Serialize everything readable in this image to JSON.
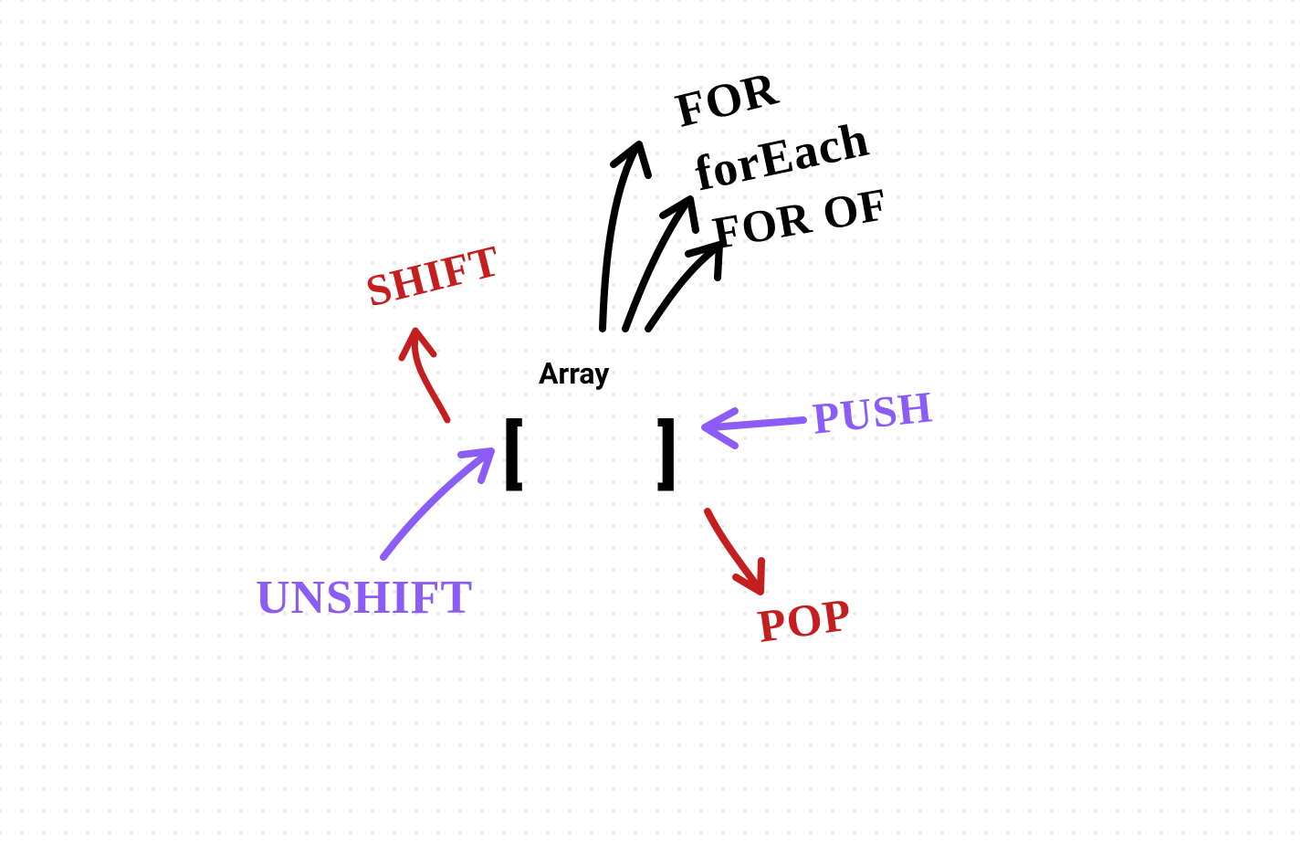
{
  "title": "Array",
  "brackets": {
    "left": "[",
    "right": "]"
  },
  "labels": {
    "shift": "SHIFT",
    "unshift": "UNSHIFT",
    "push": "PUSH",
    "pop": "POP",
    "for": "FOR",
    "foreach": "forEach",
    "forof": "FOR  OF"
  },
  "colors": {
    "red": "#c41e1e",
    "purple": "#8b5cf6",
    "black": "#111"
  }
}
